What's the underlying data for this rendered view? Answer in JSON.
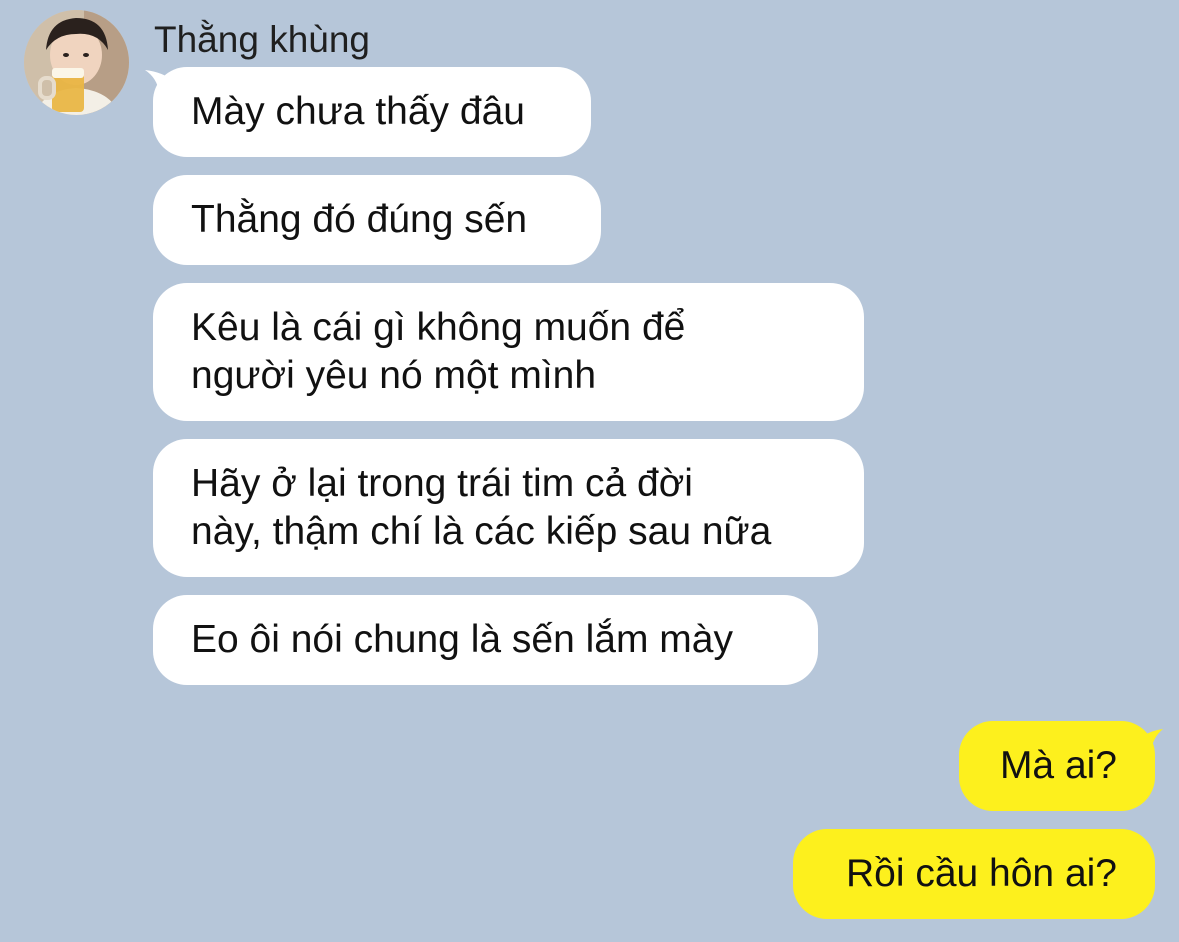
{
  "contact": {
    "name": "Thằng khùng",
    "avatar_icon": "user-avatar-photo"
  },
  "messages": [
    {
      "direction": "incoming",
      "text": "Mày chưa thấy đâu"
    },
    {
      "direction": "incoming",
      "text": "Thằng đó đúng sến"
    },
    {
      "direction": "incoming",
      "text": "Kêu là cái gì không muốn để\nngười yêu nó một mình"
    },
    {
      "direction": "incoming",
      "text": "Hãy ở lại trong trái tim cả đời\nnày, thậm chí là các kiếp sau nữa"
    },
    {
      "direction": "incoming",
      "text": "Eo ôi nói chung là sến lắm mày"
    },
    {
      "direction": "outgoing",
      "text": "Mà ai?"
    },
    {
      "direction": "outgoing",
      "text": "Rồi cầu hôn ai?"
    }
  ],
  "colors": {
    "background": "#b6c6d9",
    "incoming_bubble": "#ffffff",
    "outgoing_bubble": "#fdf01d"
  }
}
